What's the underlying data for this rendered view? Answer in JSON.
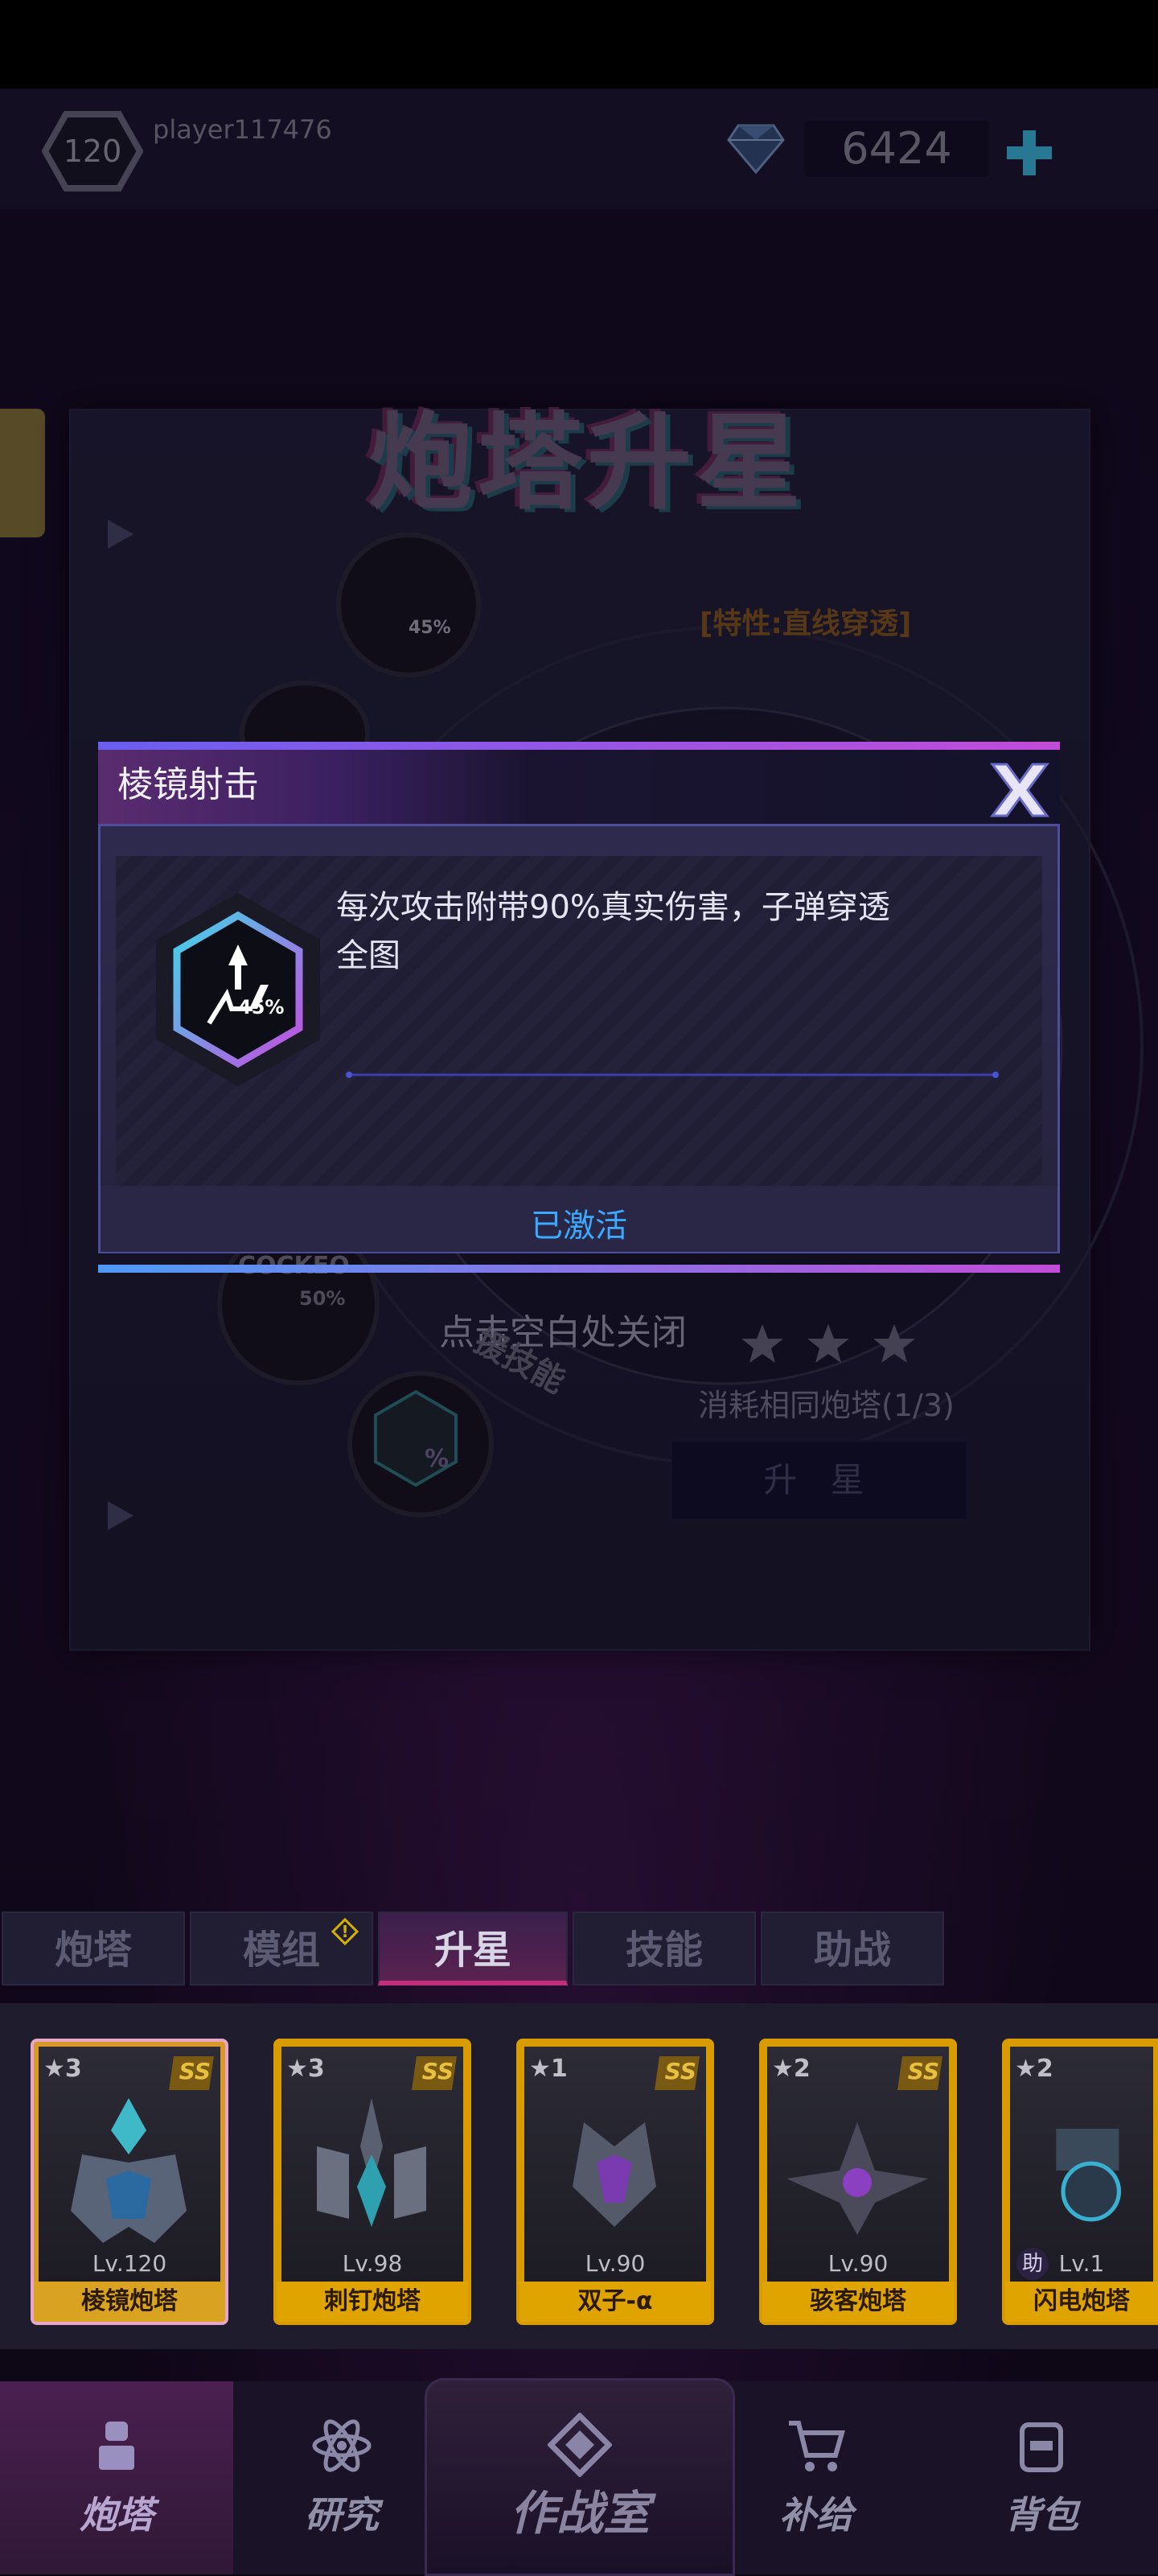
{
  "header": {
    "level": "120",
    "player_name": "player117476",
    "gem_count": "6424"
  },
  "panel": {
    "title": "炮塔升星",
    "trait": "[特性:直线穿透]",
    "skill_percent_1": "45%",
    "skill_percent_3": "50%",
    "skill_percent_4": "%",
    "close_hint": "点击空白处关闭",
    "support_skill_label": "援技能",
    "consume_text": "消耗相同炮塔(1/3)",
    "upgrade_button": "升 星",
    "skill_tag_3": "COCKEO"
  },
  "popup": {
    "title": "棱镜射击",
    "description": "每次攻击附带90%真实伤害，子弹穿透全图",
    "icon_percent": "45%",
    "status": "已激活"
  },
  "tabs": [
    {
      "label": "炮塔",
      "active": false
    },
    {
      "label": "模组",
      "active": false,
      "badge": "!"
    },
    {
      "label": "升星",
      "active": true
    },
    {
      "label": "技能",
      "active": false
    },
    {
      "label": "助战",
      "active": false
    }
  ],
  "cards": [
    {
      "stars": "★3",
      "rank": "SS",
      "level": "Lv.120",
      "name": "棱镜炮塔",
      "selected": true
    },
    {
      "stars": "★3",
      "rank": "SS",
      "level": "Lv.98",
      "name": "刺钉炮塔"
    },
    {
      "stars": "★1",
      "rank": "SS",
      "level": "Lv.90",
      "name": "双子-α"
    },
    {
      "stars": "★2",
      "rank": "SS",
      "level": "Lv.90",
      "name": "骇客炮塔"
    },
    {
      "stars": "★2",
      "rank": "SS",
      "level": "Lv.1",
      "name": "闪电炮塔",
      "tag": "助"
    }
  ],
  "nav": [
    {
      "label": "炮塔",
      "icon": "turret-icon",
      "active": true
    },
    {
      "label": "研究",
      "icon": "atom-icon"
    },
    {
      "label": "作战室",
      "icon": "diamond-icon"
    },
    {
      "label": "补给",
      "icon": "cart-icon"
    },
    {
      "label": "背包",
      "icon": "bag-icon"
    }
  ],
  "colors": {
    "accent_purple": "#c24cd8",
    "accent_blue": "#4f9bf5",
    "status_blue": "#3aa9ff",
    "card_gold": "#d99c00"
  }
}
